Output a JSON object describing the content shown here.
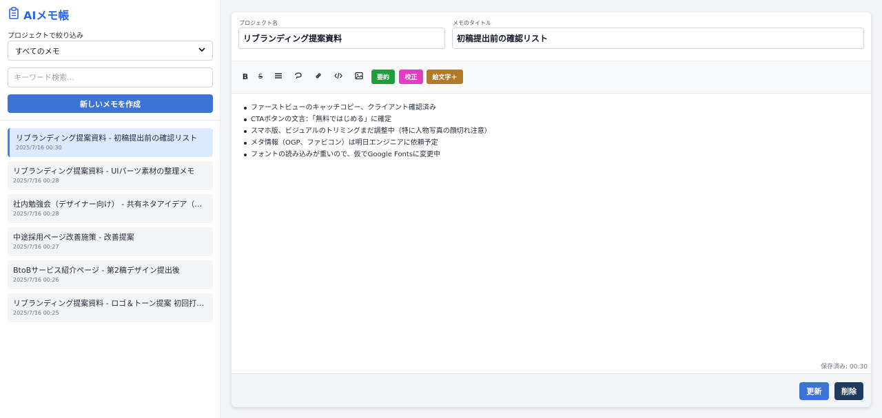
{
  "app": {
    "title": "AIメモ帳"
  },
  "sidebar": {
    "filter_label": "プロジェクトで絞り込み",
    "filter_value": "すべてのメモ",
    "search_placeholder": "キーワード検索...",
    "new_button": "新しいメモを作成",
    "memos": [
      {
        "title": "リブランディング提案資料 - 初稿提出前の確認リスト",
        "date": "2025/7/16 00:30",
        "active": true
      },
      {
        "title": "リブランディング提案資料 - UIパーツ素材の整理メモ",
        "date": "2025/7/16 00:28",
        "active": false
      },
      {
        "title": "社内勉強会（デザイナー向け） - 共有ネタアイデア（検証中）",
        "date": "2025/7/16 00:28",
        "active": false
      },
      {
        "title": "中途採用ページ改善施策 - 改善提案",
        "date": "2025/7/16 00:27",
        "active": false
      },
      {
        "title": "BtoBサービス紹介ページ - 第2稿デザイン提出後",
        "date": "2025/7/16 00:26",
        "active": false
      },
      {
        "title": "リブランディング提案資料 - ロゴ＆トーン提案 初回打ち合わせ",
        "date": "2025/7/16 00:25",
        "active": false
      }
    ]
  },
  "editor": {
    "project_label": "プロジェクト名",
    "project_value": "リブランディング提案資料",
    "title_label": "メモのタイトル",
    "title_value": "初稿提出前の確認リスト",
    "toolbar": {
      "bold": "B",
      "strike": "S",
      "summarize": "要約",
      "proofread": "校正",
      "emoji": "絵文字＋"
    },
    "content": [
      "ファーストビューのキャッチコピー、クライアント確認済み",
      "CTAボタンの文言：「無料ではじめる」に確定",
      "スマホ版、ビジュアルのトリミングまだ調整中（特に人物写真の顔切れ注意）",
      "メタ情報（OGP、ファビコン）は明日エンジニアに依頼予定",
      "フォントの読み込みが重いので、仮でGoogle Fontsに変更中"
    ],
    "saved_status": "保存済み: 00:30",
    "update_button": "更新",
    "delete_button": "削除"
  },
  "colors": {
    "accent": "#3b73d6",
    "summarize": "#1f9d3a",
    "proofread": "#e63cc3",
    "emoji": "#b27a26",
    "delete": "#1e3a5f"
  }
}
